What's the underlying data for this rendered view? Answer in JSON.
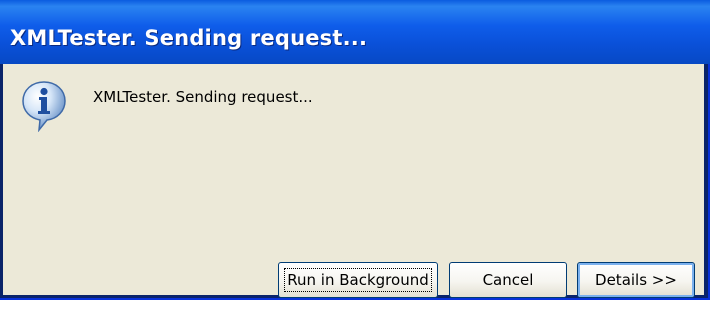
{
  "window": {
    "title": "XMLTester. Sending request..."
  },
  "dialog": {
    "icon": "information-icon",
    "message": "XMLTester. Sending request..."
  },
  "buttons": {
    "run_in_background": "Run in Background",
    "cancel": "Cancel",
    "details": "Details >>"
  },
  "colors": {
    "titlebar": "#0a50d8",
    "client_background": "#ece9d8",
    "button_border": "#003c74"
  }
}
